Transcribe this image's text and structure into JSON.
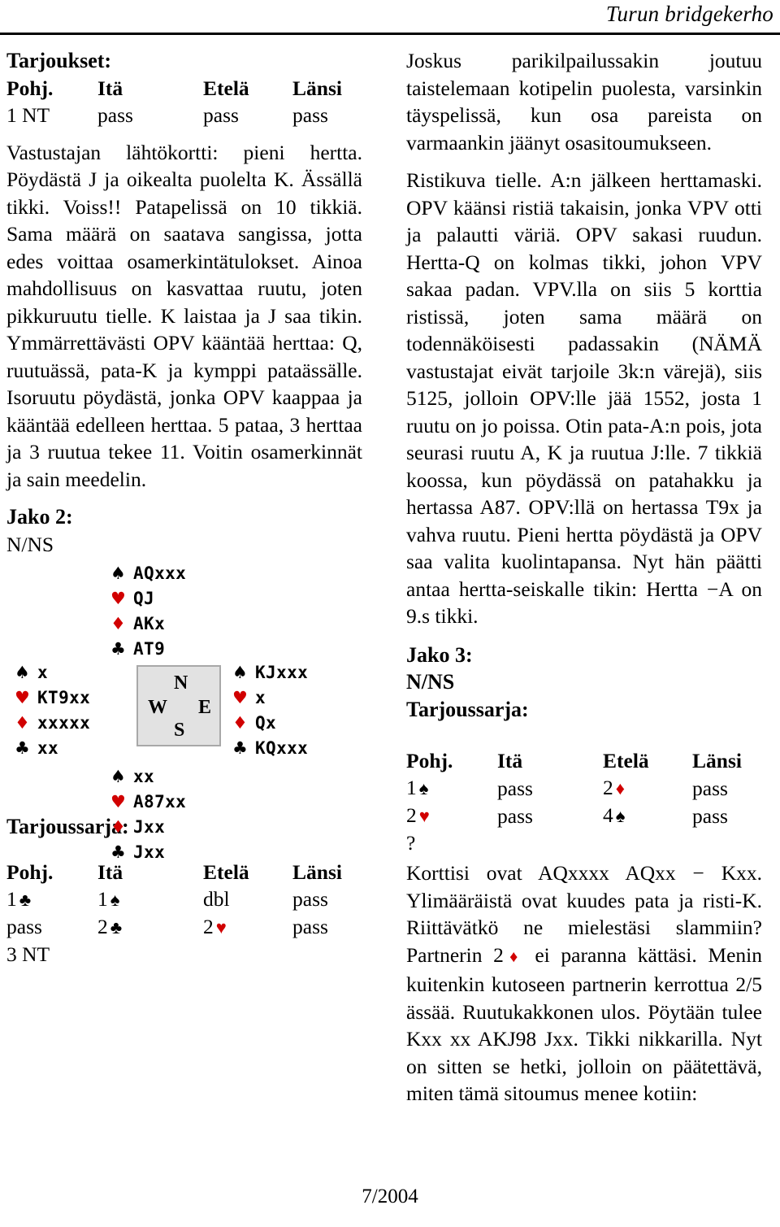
{
  "masthead": {
    "title": "Turun bridgekerho"
  },
  "footer": {
    "issue": "7/2004"
  },
  "left_column": {
    "bids_heading": "Tarjoukset:",
    "bidding_table_1": {
      "headers": [
        "Pohj.",
        "Itä",
        "Etelä",
        "Länsi"
      ],
      "rows": [
        [
          {
            "text": "1 NT",
            "suit": null
          },
          {
            "text": "pass",
            "suit": null
          },
          {
            "text": "pass",
            "suit": null
          },
          {
            "text": "pass",
            "suit": null
          }
        ]
      ]
    },
    "paragraph_1": "Vastustajan lähtökortti: pieni hertta. Pöydästä J ja oikealta puolelta K. Ässällä tikki. Voiss!! Patapelissä on 10 tikkiä. Sama määrä on saatava sangissa, jotta edes voittaa osamerkintätulokset. Ainoa mahdollisuus on kasvattaa ruutu, joten pikkuruutu tielle. K laistaa ja J saa tikin. Ymmärrettävästi OPV kääntää herttaa: Q, ruutuässä, pata-K ja kymppi pataässälle. Isoruutu pöydästä, jonka OPV kaappaa ja kääntää edelleen herttaa. 5 pataa, 3 herttaa ja 3 ruutua tekee 11. Voitin osamerkinnät ja sain meedelin.",
    "deal_heading": "Jako 2:",
    "vulnerability": "N/NS",
    "hands": {
      "north": {
        "label": "North",
        "suits": [
          {
            "symbol": "♠",
            "color": "black",
            "cards": "AQxxx"
          },
          {
            "symbol": "♥",
            "color": "red",
            "cards": "QJ"
          },
          {
            "symbol": "♦",
            "color": "red",
            "cards": "AKx"
          },
          {
            "symbol": "♣",
            "color": "black",
            "cards": "AT9"
          }
        ]
      },
      "west": {
        "label": "West",
        "suits": [
          {
            "symbol": "♠",
            "color": "black",
            "cards": "x"
          },
          {
            "symbol": "♥",
            "color": "red",
            "cards": "KT9xx"
          },
          {
            "symbol": "♦",
            "color": "red",
            "cards": "xxxxx"
          },
          {
            "symbol": "♣",
            "color": "black",
            "cards": "xx"
          }
        ]
      },
      "east": {
        "label": "East",
        "suits": [
          {
            "symbol": "♠",
            "color": "black",
            "cards": "KJxxx"
          },
          {
            "symbol": "♥",
            "color": "red",
            "cards": "x"
          },
          {
            "symbol": "♦",
            "color": "red",
            "cards": "Qx"
          },
          {
            "symbol": "♣",
            "color": "black",
            "cards": "KQxxx"
          }
        ]
      },
      "south": {
        "label": "South",
        "suits": [
          {
            "symbol": "♠",
            "color": "black",
            "cards": "xx"
          },
          {
            "symbol": "♥",
            "color": "red",
            "cards": "A87xx"
          },
          {
            "symbol": "♦",
            "color": "red",
            "cards": "Jxx"
          },
          {
            "symbol": "♣",
            "color": "black",
            "cards": "Jxx"
          }
        ]
      }
    },
    "compass": {
      "n": "N",
      "w": "W",
      "e": "E",
      "s": "S"
    },
    "bidseries_heading": "Tarjoussarja:",
    "bidding_table_2": {
      "headers": [
        "Pohj.",
        "Itä",
        "Etelä",
        "Länsi"
      ],
      "rows": [
        [
          {
            "text": "1",
            "suit": "♣",
            "suit_color": "black"
          },
          {
            "text": "1",
            "suit": "♠",
            "suit_color": "black"
          },
          {
            "text": "dbl",
            "suit": null
          },
          {
            "text": "pass",
            "suit": null
          }
        ],
        [
          {
            "text": "pass",
            "suit": null
          },
          {
            "text": "2",
            "suit": "♣",
            "suit_color": "black"
          },
          {
            "text": "2",
            "suit": "♥",
            "suit_color": "red"
          },
          {
            "text": "pass",
            "suit": null
          }
        ],
        [
          {
            "text": "3 NT",
            "suit": null
          },
          {
            "text": "",
            "suit": null
          },
          {
            "text": "",
            "suit": null
          },
          {
            "text": "",
            "suit": null
          }
        ]
      ]
    }
  },
  "right_column": {
    "paragraph_1": "Joskus parikilpailussakin joutuu taistelemaan kotipelin puolesta, varsinkin täyspelissä, kun osa pareista on varmaankin jäänyt osasitoumukseen.",
    "paragraph_2": "Ristikuva tielle. A:n jälkeen herttamaski. OPV käänsi ristiä takaisin, jonka VPV otti ja palautti väriä. OPV sakasi ruudun. Hertta-Q on kolmas tikki, johon VPV sakaa padan. VPV.lla on siis 5 korttia ristissä, joten sama määrä on todennäköisesti padassakin (NÄMÄ vastustajat eivät tarjoile 3k:n värejä), siis 5125, jolloin OPV:lle jää 1552, josta 1 ruutu on jo poissa. Otin pata-A:n pois, jota seurasi ruutu A, K ja ruutua J:lle. 7 tikkiä koossa, kun pöydässä on patahakku ja hertassa A87. OPV:llä on hertassa T9x ja vahva ruutu. Pieni hertta pöydästä ja OPV saa valita kuolintapansa. Nyt hän päätti antaa hertta-seiskalle tikin: Hertta −A on 9.s tikki.",
    "deal_heading": "Jako 3:",
    "vulnerability": "N/NS",
    "bidseries_heading": "Tarjoussarja:",
    "bidding_table": {
      "headers": [
        "Pohj.",
        "Itä",
        "Etelä",
        "Länsi"
      ],
      "rows": [
        [
          {
            "text": "1",
            "suit": "♠",
            "suit_color": "black"
          },
          {
            "text": "pass",
            "suit": null
          },
          {
            "text": "2",
            "suit": "♦",
            "suit_color": "red"
          },
          {
            "text": "pass",
            "suit": null
          }
        ],
        [
          {
            "text": "2",
            "suit": "♥",
            "suit_color": "red"
          },
          {
            "text": "pass",
            "suit": null
          },
          {
            "text": "4",
            "suit": "♠",
            "suit_color": "black"
          },
          {
            "text": "pass",
            "suit": null
          }
        ],
        [
          {
            "text": "?",
            "suit": null
          },
          {
            "text": "",
            "suit": null
          },
          {
            "text": "",
            "suit": null
          },
          {
            "text": "",
            "suit": null
          }
        ]
      ]
    },
    "paragraph_3_part1": "Korttisi ovat AQxxxx AQxx − Kxx. Ylimääräistä ovat kuudes pata ja risti-K. Riittävätkö ne mielestäsi slammiin? Partnerin 2",
    "paragraph_3_suit": "♦",
    "paragraph_3_part2": "ei paranna kättäsi. Menin kuitenkin kutoseen partnerin kerrottua 2/5 ässää. Ruutukakkonen ulos. Pöytään tulee Kxx xx AKJ98 Jxx. Tikki nikkarilla. Nyt on sitten se hetki, jolloin on päätettävä, miten tämä sitoumus menee kotiin:"
  }
}
